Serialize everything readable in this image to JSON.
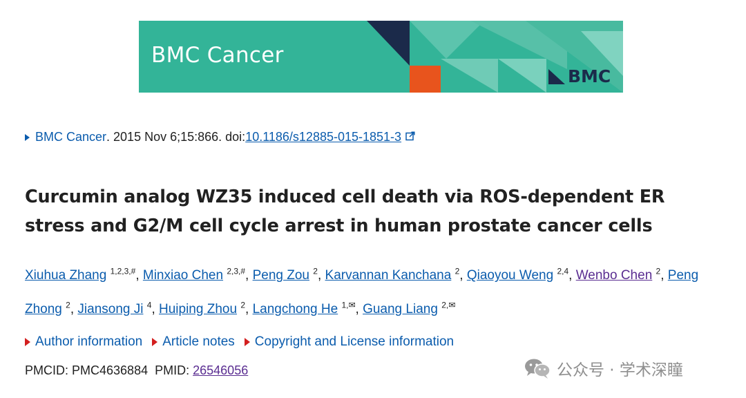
{
  "banner": {
    "journal_title": "BMC Cancer",
    "publisher_logo": "BMC",
    "colors": {
      "background": "#33b498",
      "navy": "#1b2a4a",
      "orange": "#e8541d"
    }
  },
  "citation": {
    "journal": "BMC Cancer",
    "details": ". 2015 Nov 6;15:866. doi: ",
    "doi": "10.1186/s12885-015-1851-3"
  },
  "article": {
    "title": "Curcumin analog WZ35 induced cell death via ROS-dependent ER stress and G2/M cell cycle arrest in human prostate cancer cells"
  },
  "authors": [
    {
      "name": "Xiuhua Zhang",
      "sup": "1,2,3,#",
      "sep": ", "
    },
    {
      "name": "Minxiao Chen",
      "sup": "2,3,#",
      "sep": ", "
    },
    {
      "name": "Peng Zou",
      "sup": "2",
      "sep": ", "
    },
    {
      "name": "Karvannan Kanchana",
      "sup": "2",
      "sep": ", "
    },
    {
      "name": "Qiaoyou Weng",
      "sup": "2,4",
      "sep": ", "
    },
    {
      "name": "Wenbo Chen",
      "sup": "2",
      "sep": ", "
    },
    {
      "name": "Peng Zhong",
      "sup": "2",
      "sep": ", "
    },
    {
      "name": "Jiansong Ji",
      "sup": "4",
      "sep": ", "
    },
    {
      "name": "Huiping Zhou",
      "sup": "2",
      "sep": ", "
    },
    {
      "name": "Langchong He",
      "sup": "1,✉",
      "sep": ", "
    },
    {
      "name": "Guang Liang",
      "sup": "2,✉",
      "sep": ""
    }
  ],
  "info_toggles": {
    "author_information": "Author information",
    "article_notes": "Article notes",
    "copyright": "Copyright and License information"
  },
  "ids": {
    "pmcid_label": "PMCID: ",
    "pmcid": "PMC4636884",
    "pmid_label": "PMID: ",
    "pmid": "26546056"
  },
  "watermark": {
    "text": "公众号 · 学术深瞳",
    "icon": "wechat-icon"
  }
}
